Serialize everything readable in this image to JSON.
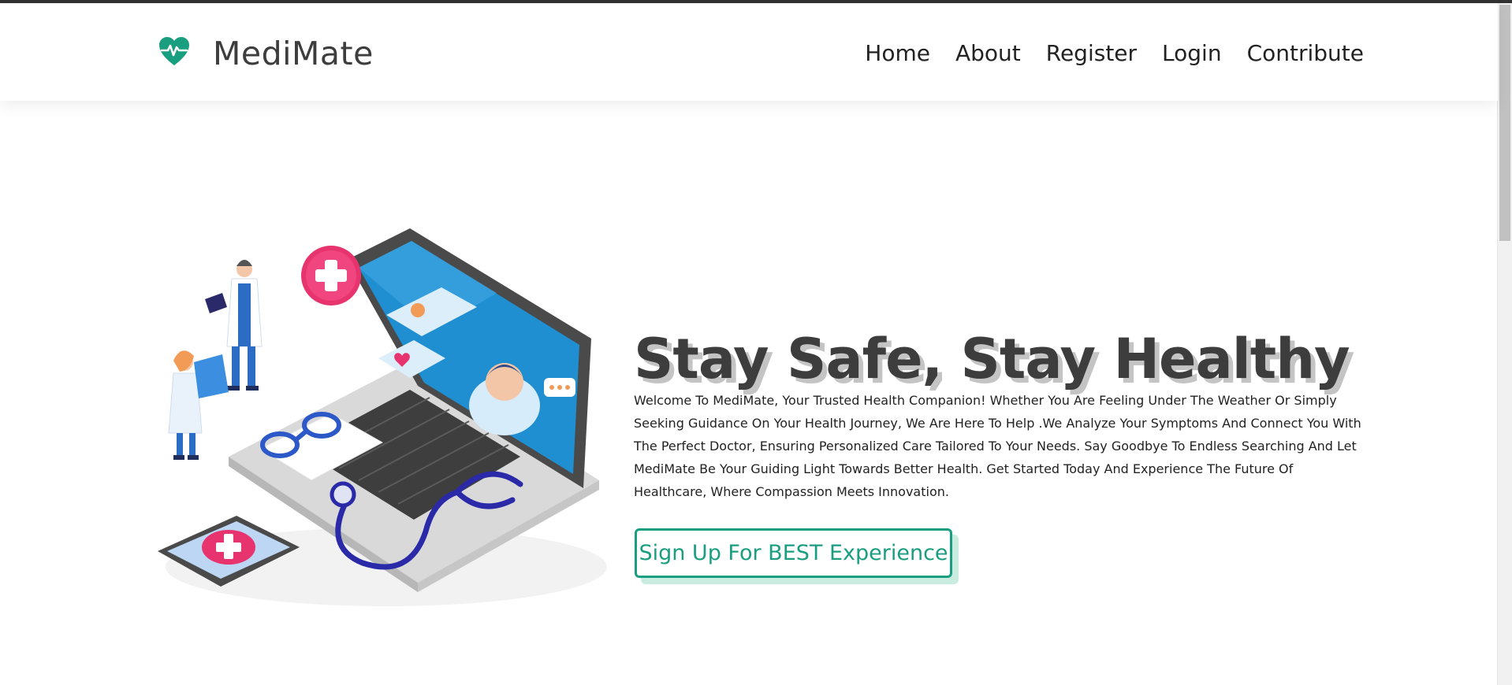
{
  "brand": {
    "name": "MediMate",
    "logo_icon": "heart-pulse-icon",
    "accent_color": "#1a9e80"
  },
  "nav": {
    "items": [
      {
        "label": "Home"
      },
      {
        "label": "About"
      },
      {
        "label": "Register"
      },
      {
        "label": "Login"
      },
      {
        "label": "Contribute"
      }
    ]
  },
  "hero": {
    "title": "Stay Safe, Stay Healthy",
    "body": "Welcome To MediMate, Your Trusted Health Companion! Whether You Are Feeling Under The Weather Or Simply Seeking Guidance On Your Health Journey, We Are Here To Help .We Analyze Your Symptoms And Connect You With The Perfect Doctor, Ensuring Personalized Care Tailored To Your Needs. Say Goodbye To Endless Searching And Let MediMate Be Your Guiding Light Towards Better Health. Get Started Today And Experience The Future Of Healthcare, Where Compassion Meets Innovation.",
    "cta_label": "Sign Up For BEST Experience",
    "illustration": "doctors-laptop-illustration"
  },
  "colors": {
    "title": "#3d3d3d",
    "title_shadow": "#c4c4c4",
    "cta_shadow": "#c9ece0"
  }
}
